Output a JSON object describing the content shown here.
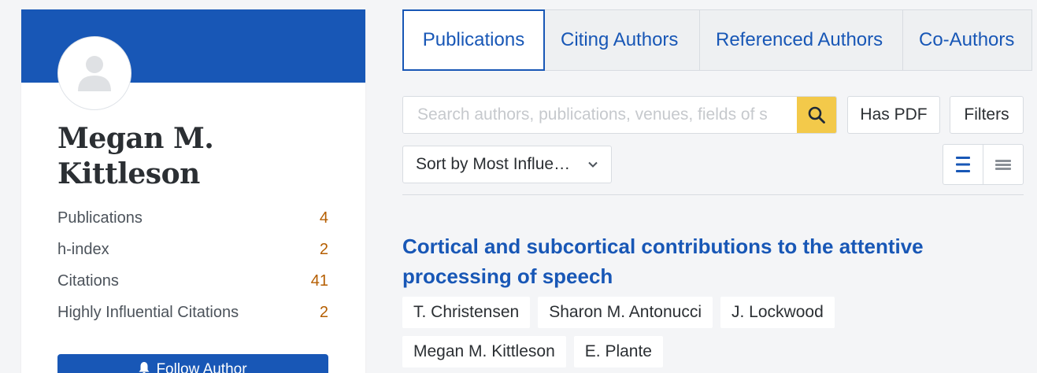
{
  "profile": {
    "name": "Megan M. Kittleson",
    "stats": [
      {
        "label": "Publications",
        "value": "4"
      },
      {
        "label": "h-index",
        "value": "2"
      },
      {
        "label": "Citations",
        "value": "41"
      },
      {
        "label": "Highly Influential Citations",
        "value": "2"
      }
    ],
    "follow_label": "Follow Author"
  },
  "tabs": [
    {
      "label": "Publications",
      "active": true
    },
    {
      "label": "Citing Authors",
      "active": false
    },
    {
      "label": "Referenced Authors",
      "active": false
    },
    {
      "label": "Co-Authors",
      "active": false
    }
  ],
  "search": {
    "placeholder": "Search authors, publications, venues, fields of s",
    "value": ""
  },
  "controls": {
    "has_pdf_label": "Has PDF",
    "filters_label": "Filters",
    "sort_label": "Sort by Most Influe…"
  },
  "paper": {
    "title": "Cortical and subcortical contributions to the attentive processing of speech",
    "authors": [
      "T. Christensen",
      "Sharon M. Antonucci",
      "J. Lockwood",
      "Megan M. Kittleson",
      "E. Plante"
    ]
  },
  "colors": {
    "brand_blue": "#1857b6",
    "search_yellow": "#f3c94a",
    "stat_orange": "#b55e00",
    "background": "#f4f5f7"
  },
  "icons": {
    "avatar": "person-silhouette-icon",
    "search": "search-icon",
    "follow": "bell-icon",
    "sort": "chevron-down-icon",
    "list_view": "list-view-icon",
    "compact_view": "compact-list-icon"
  }
}
